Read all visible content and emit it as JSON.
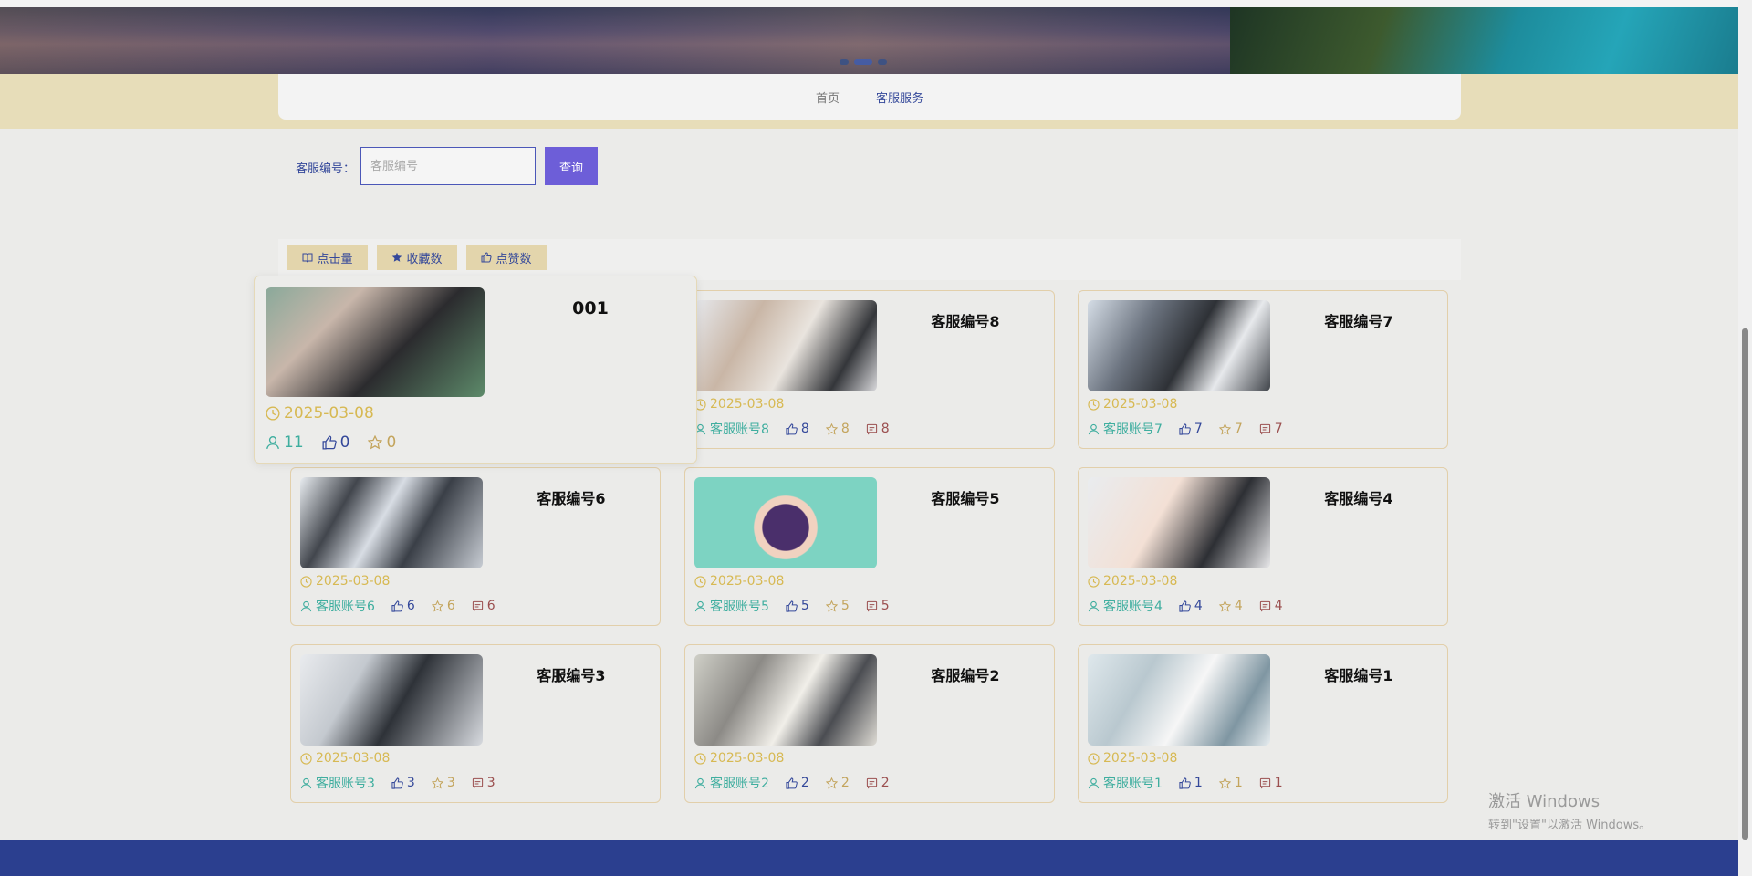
{
  "nav": {
    "home": "首页",
    "service": "客服服务"
  },
  "search": {
    "label": "客服编号：",
    "placeholder": "客服编号",
    "value": "",
    "button": "查询"
  },
  "sort": {
    "clicks": "点击量",
    "favorites": "收藏数",
    "likes": "点赞数"
  },
  "hover_card": {
    "title": "001",
    "date": "2025-03-08",
    "clicks": "11",
    "likes": "0",
    "favorites": "0"
  },
  "cards": [
    {
      "title": "客服编号8",
      "date": "2025-03-08",
      "account": "客服账号8",
      "likes": "8",
      "favorites": "8",
      "comments": "8"
    },
    {
      "title": "客服编号7",
      "date": "2025-03-08",
      "account": "客服账号7",
      "likes": "7",
      "favorites": "7",
      "comments": "7"
    },
    {
      "title": "客服编号6",
      "date": "2025-03-08",
      "account": "客服账号6",
      "likes": "6",
      "favorites": "6",
      "comments": "6"
    },
    {
      "title": "客服编号5",
      "date": "2025-03-08",
      "account": "客服账号5",
      "likes": "5",
      "favorites": "5",
      "comments": "5"
    },
    {
      "title": "客服编号4",
      "date": "2025-03-08",
      "account": "客服账号4",
      "likes": "4",
      "favorites": "4",
      "comments": "4"
    },
    {
      "title": "客服编号3",
      "date": "2025-03-08",
      "account": "客服账号3",
      "likes": "3",
      "favorites": "3",
      "comments": "3"
    },
    {
      "title": "客服编号2",
      "date": "2025-03-08",
      "account": "客服账号2",
      "likes": "2",
      "favorites": "2",
      "comments": "2"
    },
    {
      "title": "客服编号1",
      "date": "2025-03-08",
      "account": "客服账号1",
      "likes": "1",
      "favorites": "1",
      "comments": "1"
    }
  ],
  "watermark": {
    "line1": "激活 Windows",
    "line2": "转到\"设置\"以激活 Windows。"
  },
  "colors": {
    "accent": "#34489a",
    "button": "#6d5ed8",
    "date": "#d7b953",
    "footer": "#2b3f8f",
    "navband": "#e7ddb9"
  }
}
